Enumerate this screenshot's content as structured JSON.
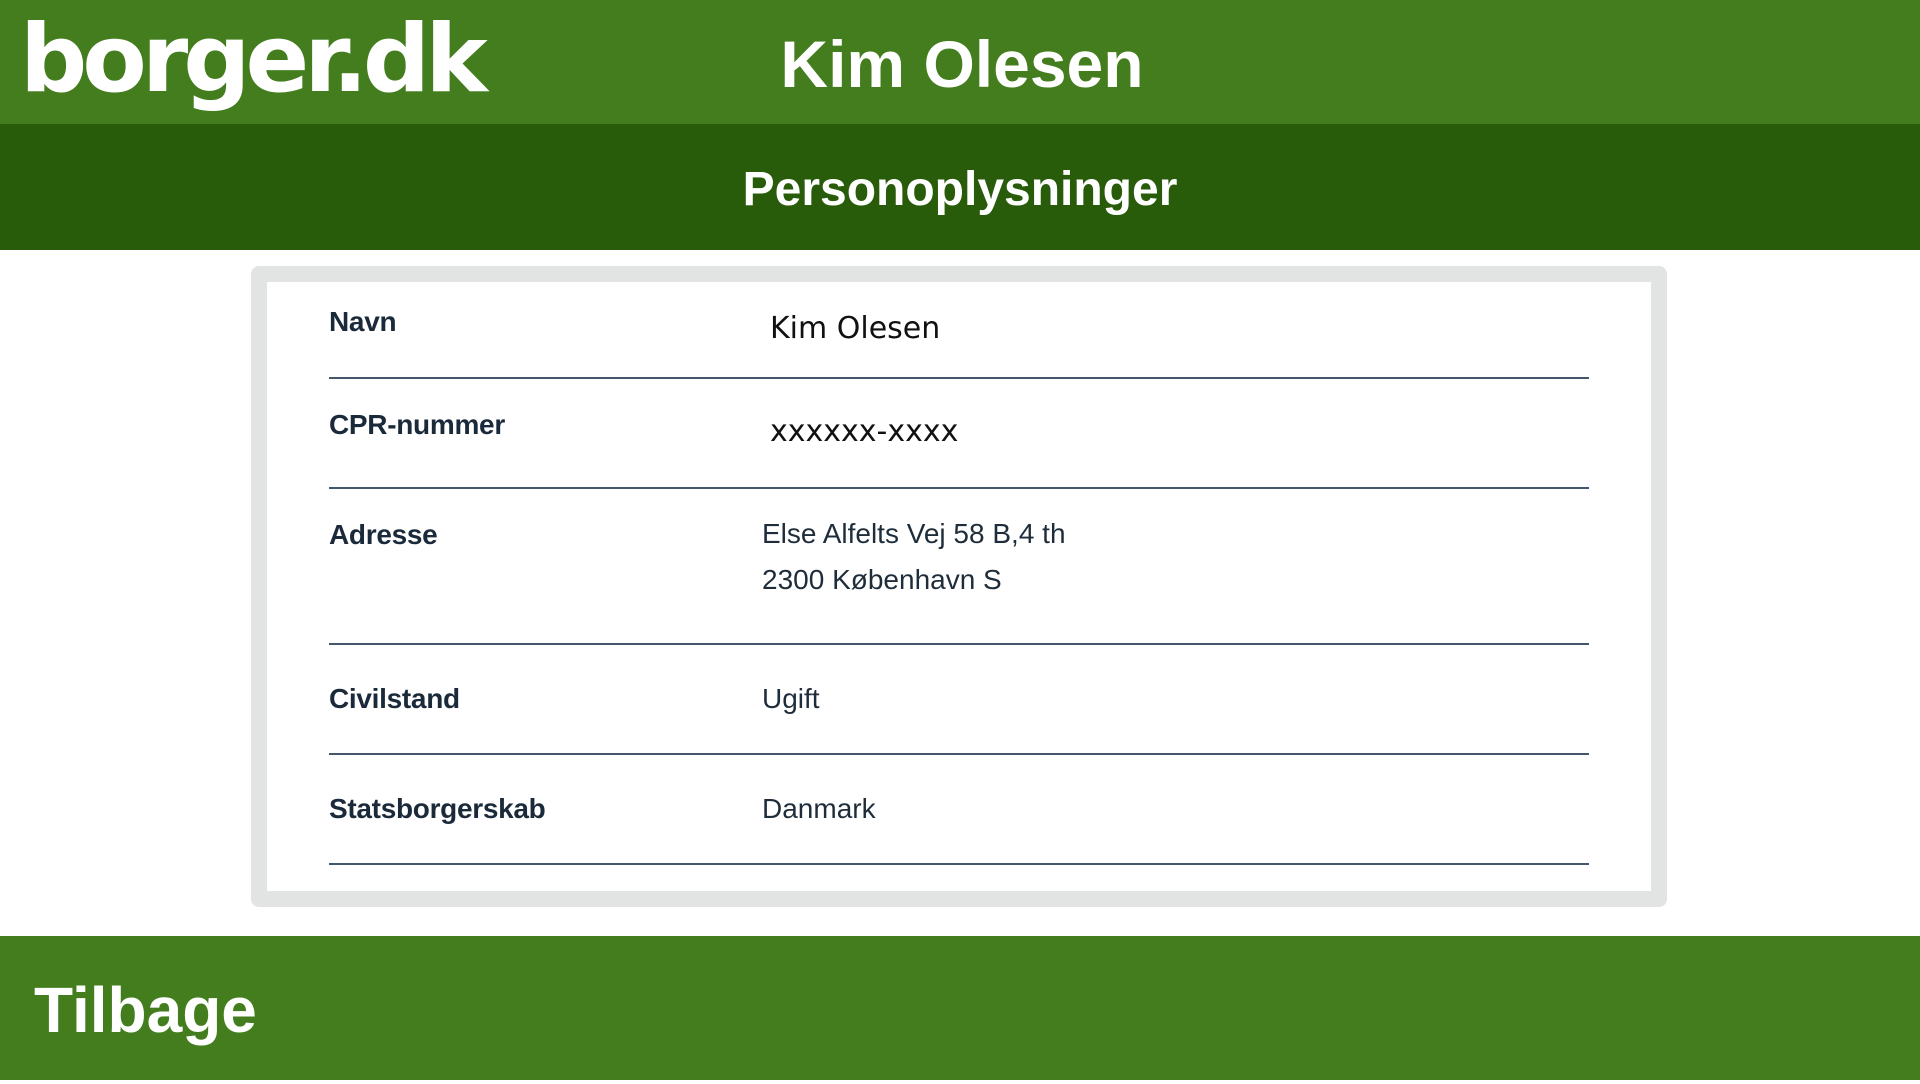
{
  "header": {
    "logo": "borger.dk",
    "user_name": "Kim Olesen"
  },
  "subheader": {
    "title": "Personoplysninger"
  },
  "details": {
    "rows": [
      {
        "label": "Navn",
        "value": "Kim Olesen"
      },
      {
        "label": "CPR-nummer",
        "value": "xxxxxx-xxxx"
      },
      {
        "label": "Adresse",
        "value_line1": "Else Alfelts Vej 58 B,4 th",
        "value_line2": "2300 København S"
      },
      {
        "label": "Civilstand",
        "value": "Ugift"
      },
      {
        "label": "Statsborgerskab",
        "value": "Danmark"
      }
    ]
  },
  "footer": {
    "back_label": "Tilbage"
  },
  "colors": {
    "header_green": "#437d1e",
    "subheader_green": "#285b0a",
    "card_border": "#e1e4e3",
    "divider": "#45576b"
  }
}
